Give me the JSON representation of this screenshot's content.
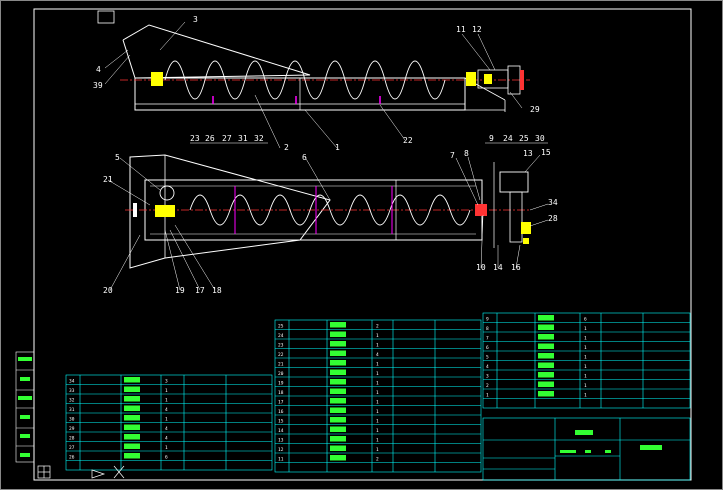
{
  "callouts": {
    "top": [
      "3",
      "4",
      "39",
      "11",
      "12",
      "29",
      "2",
      "1",
      "22"
    ],
    "bottom": [
      "23",
      "26",
      "27",
      "31",
      "32",
      "5",
      "6",
      "9",
      "24",
      "25",
      "30",
      "7",
      "8",
      "13",
      "15",
      "21",
      "34",
      "28",
      "10",
      "14",
      "16",
      "20",
      "19",
      "17",
      "18"
    ]
  },
  "tables": {
    "left_rows": [
      "34",
      "33",
      "32",
      "31",
      "30",
      "29",
      "28",
      "27",
      "26"
    ],
    "mid_rows": [
      "25",
      "24",
      "23",
      "22",
      "21",
      "20",
      "19",
      "18",
      "17",
      "16",
      "15",
      "14",
      "13",
      "12",
      "11"
    ],
    "right_rows": [
      "9",
      "8",
      "7",
      "6",
      "5",
      "4",
      "3",
      "2",
      "1"
    ],
    "mid_qty": [
      "2",
      "1",
      "1",
      "4",
      "1",
      "1",
      "1",
      "1",
      "1",
      "1",
      "1",
      "1",
      "1",
      "1",
      "2"
    ],
    "right_qty": [
      "6",
      "1",
      "1",
      "1",
      "1",
      "1",
      "1",
      "1",
      "1"
    ],
    "left_qty": [
      "3",
      "1",
      "1",
      "4",
      "1",
      "4",
      "4",
      "1",
      "6"
    ]
  },
  "colors": {
    "frame": "#ffffff",
    "table": "#00ffff",
    "part": "#ffffff",
    "center": "#ff3333",
    "accent": "#ffff00",
    "hatch": "#ff00ff"
  }
}
